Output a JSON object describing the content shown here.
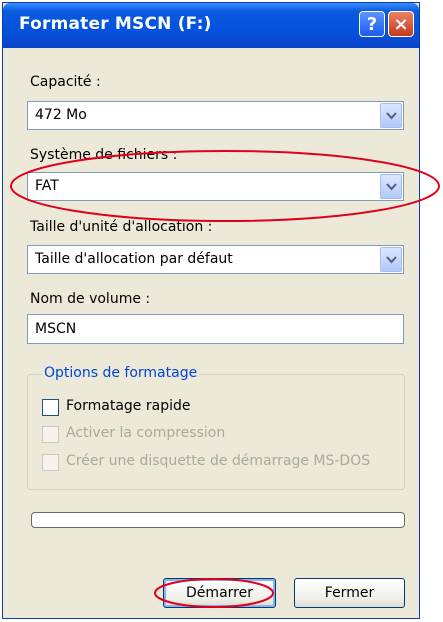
{
  "window": {
    "title": "Formater MSCN (F:)",
    "help_glyph": "?",
    "close_glyph": "×"
  },
  "capacity": {
    "label": "Capacité :",
    "value": "472 Mo"
  },
  "filesystem": {
    "label": "Système de fichiers :",
    "value": "FAT"
  },
  "allocation": {
    "label": "Taille d'unité d'allocation :",
    "value": "Taille d'allocation par défaut"
  },
  "volume": {
    "label": "Nom de volume :",
    "value": "MSCN"
  },
  "options": {
    "title": "Options de formatage",
    "quick_format": {
      "label": "Formatage rapide",
      "checked": false,
      "enabled": true
    },
    "compression": {
      "label": "Activer la compression",
      "checked": false,
      "enabled": false
    },
    "msdos_disk": {
      "label": "Créer une disquette de démarrage MS-DOS",
      "checked": false,
      "enabled": false
    }
  },
  "progress": {
    "value": 0
  },
  "buttons": {
    "start": "Démarrer",
    "close": "Fermer"
  },
  "colors": {
    "title_bar": "#0552de",
    "annotation": "#e0001b",
    "group_title": "#0046d5",
    "dialog_bg": "#ece9d8"
  }
}
